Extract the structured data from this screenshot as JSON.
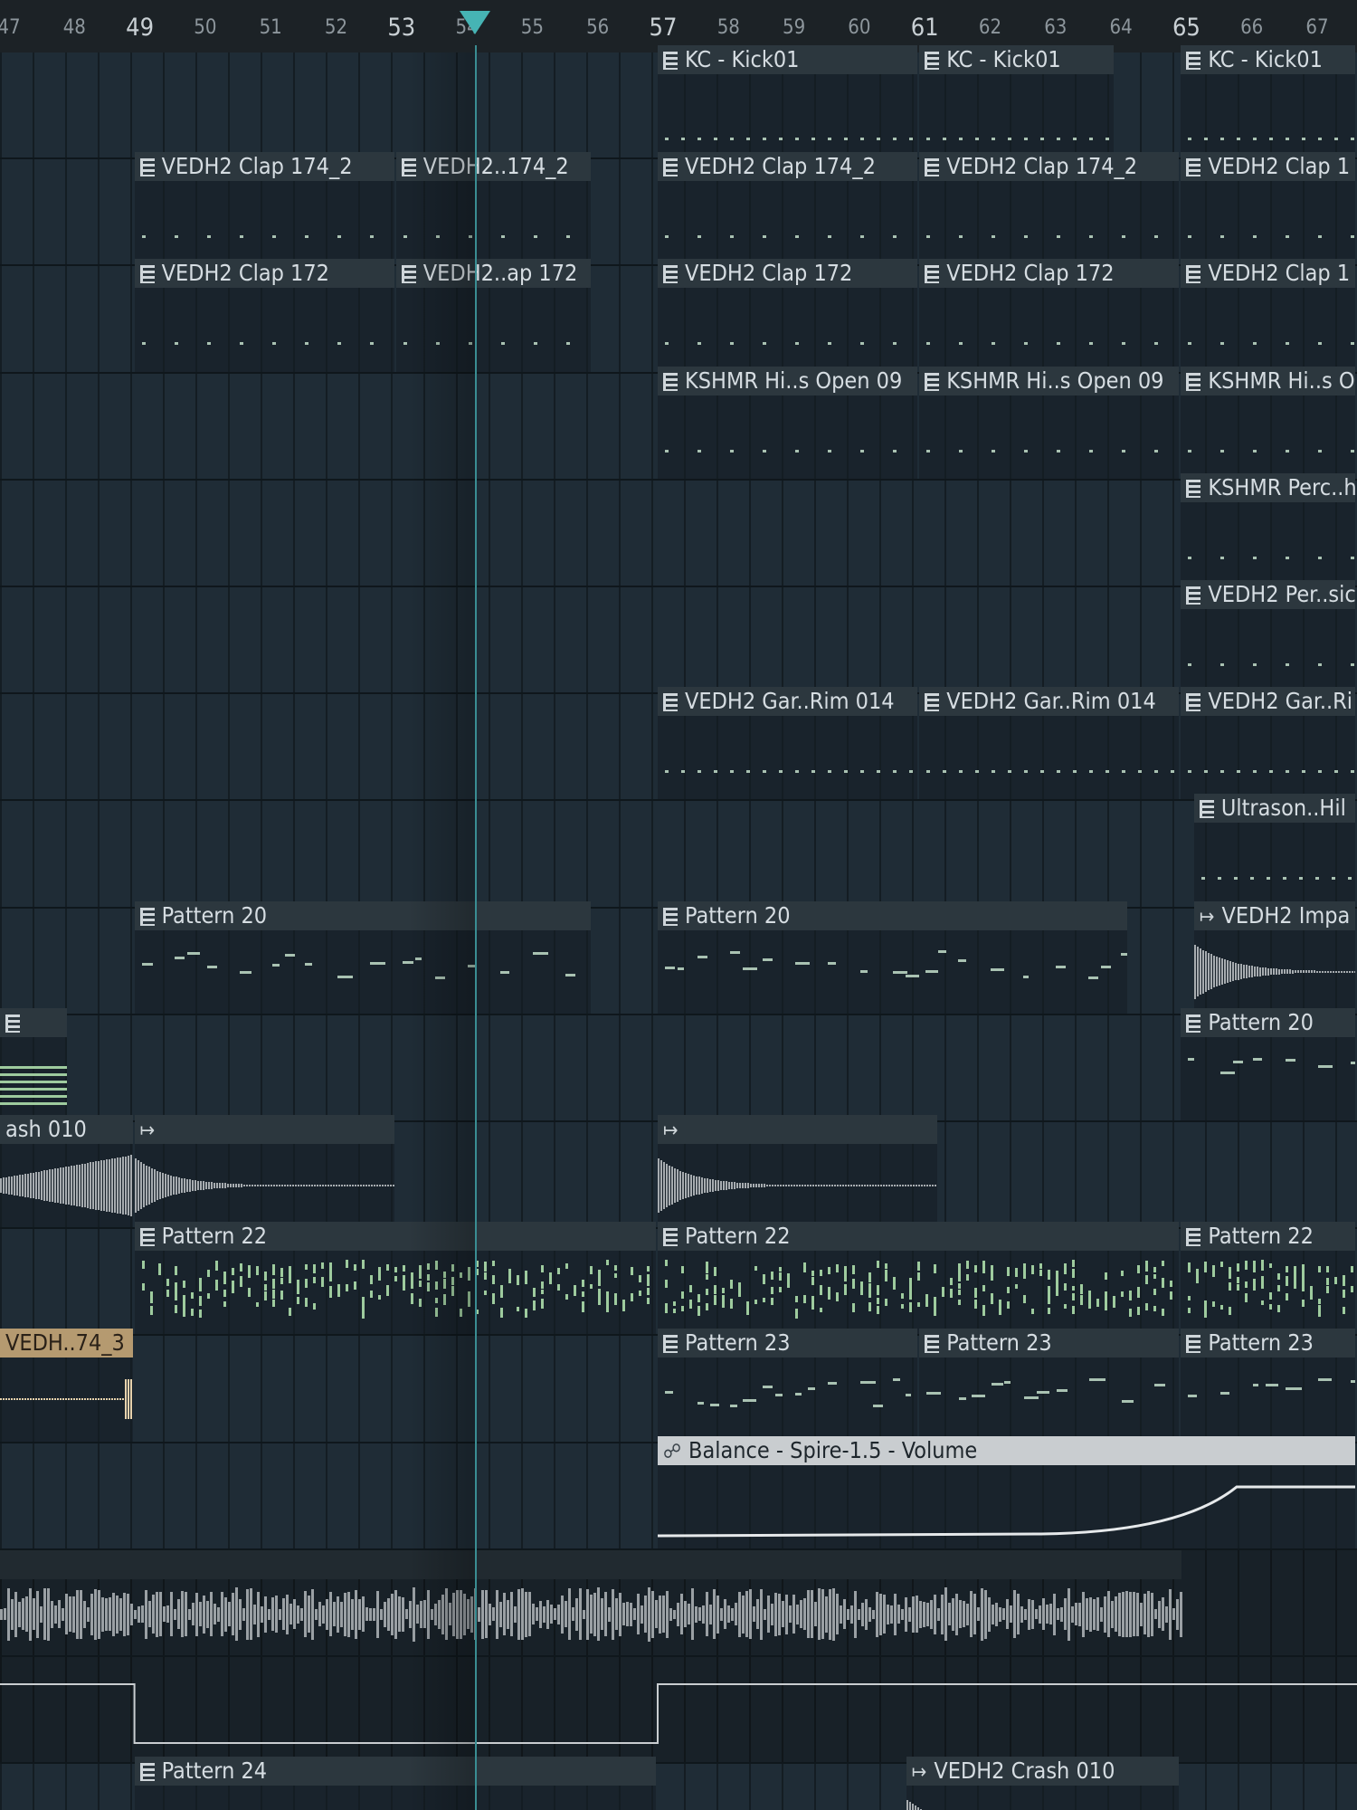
{
  "ruler": {
    "bars": [
      {
        "label": "47",
        "major": false
      },
      {
        "label": "48",
        "major": false
      },
      {
        "label": "49",
        "major": true
      },
      {
        "label": "50",
        "major": false
      },
      {
        "label": "51",
        "major": false
      },
      {
        "label": "52",
        "major": false
      },
      {
        "label": "53",
        "major": true
      },
      {
        "label": "54",
        "major": false
      },
      {
        "label": "55",
        "major": false
      },
      {
        "label": "56",
        "major": false
      },
      {
        "label": "57",
        "major": true
      },
      {
        "label": "58",
        "major": false
      },
      {
        "label": "59",
        "major": false
      },
      {
        "label": "60",
        "major": false
      },
      {
        "label": "61",
        "major": true
      },
      {
        "label": "62",
        "major": false
      },
      {
        "label": "63",
        "major": false
      },
      {
        "label": "64",
        "major": false
      },
      {
        "label": "65",
        "major": true
      },
      {
        "label": "66",
        "major": false
      },
      {
        "label": "67",
        "major": false
      }
    ],
    "playhead_bar": 54.2
  },
  "colors": {
    "accent": "#46b4b4",
    "clip_header": "#2c373e",
    "automation_header": "#c9cdd0",
    "audio_tan": "#b59a70",
    "note_color": "#a9c2b2"
  },
  "tracks": [
    {
      "clips": [
        {
          "label": "KC - Kick01",
          "start": 57,
          "end": 61,
          "kind": "pattern"
        },
        {
          "label": "KC - Kick01",
          "start": 61,
          "end": 64,
          "kind": "pattern"
        },
        {
          "label": "KC - Kick01",
          "start": 65,
          "end": 68,
          "kind": "pattern"
        }
      ]
    },
    {
      "clips": [
        {
          "label": "VEDH2 Clap 174_2",
          "start": 49,
          "end": 53,
          "kind": "pattern"
        },
        {
          "label": "VEDH2..174_2",
          "start": 53,
          "end": 56,
          "kind": "pattern"
        },
        {
          "label": "VEDH2 Clap 174_2",
          "start": 57,
          "end": 61,
          "kind": "pattern"
        },
        {
          "label": "VEDH2 Clap 174_2",
          "start": 61,
          "end": 65,
          "kind": "pattern"
        },
        {
          "label": "VEDH2 Clap 1",
          "start": 65,
          "end": 68,
          "kind": "pattern"
        }
      ]
    },
    {
      "clips": [
        {
          "label": "VEDH2 Clap 172",
          "start": 49,
          "end": 53,
          "kind": "pattern"
        },
        {
          "label": "VEDH2..ap 172",
          "start": 53,
          "end": 56,
          "kind": "pattern"
        },
        {
          "label": "VEDH2 Clap 172",
          "start": 57,
          "end": 61,
          "kind": "pattern"
        },
        {
          "label": "VEDH2 Clap 172",
          "start": 61,
          "end": 65,
          "kind": "pattern"
        },
        {
          "label": "VEDH2 Clap 1",
          "start": 65,
          "end": 68,
          "kind": "pattern"
        }
      ]
    },
    {
      "clips": [
        {
          "label": "KSHMR Hi..s Open 09",
          "start": 57,
          "end": 61,
          "kind": "pattern"
        },
        {
          "label": "KSHMR Hi..s Open 09",
          "start": 61,
          "end": 65,
          "kind": "pattern"
        },
        {
          "label": "KSHMR Hi..s Op",
          "start": 65,
          "end": 68,
          "kind": "pattern"
        }
      ]
    },
    {
      "clips": [
        {
          "label": "KSHMR Perc..h",
          "start": 65,
          "end": 68,
          "kind": "pattern"
        }
      ]
    },
    {
      "clips": [
        {
          "label": "VEDH2 Per..sic",
          "start": 65,
          "end": 68,
          "kind": "pattern"
        }
      ]
    },
    {
      "clips": [
        {
          "label": "VEDH2 Gar..Rim 014",
          "start": 57,
          "end": 61,
          "kind": "pattern"
        },
        {
          "label": "VEDH2 Gar..Rim 014",
          "start": 61,
          "end": 65,
          "kind": "pattern"
        },
        {
          "label": "VEDH2 Gar..Ri",
          "start": 65,
          "end": 68,
          "kind": "pattern"
        }
      ]
    },
    {
      "clips": [
        {
          "label": "Ultrason..Hil",
          "start": 65.2,
          "end": 68,
          "kind": "pattern"
        }
      ]
    },
    {
      "clips": [
        {
          "label": "Pattern 20",
          "start": 49,
          "end": 56,
          "kind": "pattern"
        },
        {
          "label": "Pattern 20",
          "start": 57,
          "end": 64.2,
          "kind": "pattern"
        },
        {
          "label": "VEDH2 Impa",
          "start": 65.2,
          "end": 68,
          "kind": "audio"
        }
      ]
    },
    {
      "clips": [
        {
          "label": "",
          "start": 46.5,
          "end": 48,
          "kind": "pattern"
        },
        {
          "label": "Pattern 20",
          "start": 65,
          "end": 68,
          "kind": "pattern"
        }
      ]
    },
    {
      "clips": [
        {
          "label": "ash 010",
          "start": 46.5,
          "end": 49,
          "kind": "audio-noicon"
        },
        {
          "label": "",
          "start": 49,
          "end": 53,
          "kind": "audio"
        },
        {
          "label": "",
          "start": 57,
          "end": 61.3,
          "kind": "audio"
        }
      ]
    },
    {
      "clips": [
        {
          "label": "Pattern 22",
          "start": 49,
          "end": 57,
          "kind": "pattern"
        },
        {
          "label": "Pattern 22",
          "start": 57,
          "end": 65,
          "kind": "pattern"
        },
        {
          "label": "Pattern 22",
          "start": 65,
          "end": 68,
          "kind": "pattern"
        }
      ]
    },
    {
      "clips": [
        {
          "label": "VEDH..74_3",
          "start": 46.5,
          "end": 49,
          "kind": "tan"
        },
        {
          "label": "Pattern 23",
          "start": 57,
          "end": 61,
          "kind": "pattern"
        },
        {
          "label": "Pattern 23",
          "start": 61,
          "end": 65,
          "kind": "pattern"
        },
        {
          "label": "Pattern 23",
          "start": 65,
          "end": 68,
          "kind": "pattern"
        }
      ]
    },
    {
      "clips": [
        {
          "label": "Balance - Spire-1.5 - Volume",
          "start": 57,
          "end": 68,
          "kind": "automation"
        }
      ]
    },
    {
      "clips": []
    },
    {
      "clips": []
    },
    {
      "clips": [
        {
          "label": "Pattern 24",
          "start": 49,
          "end": 57,
          "kind": "pattern"
        },
        {
          "label": "VEDH2 Crash 010",
          "start": 60.8,
          "end": 65,
          "kind": "audio"
        }
      ]
    }
  ]
}
